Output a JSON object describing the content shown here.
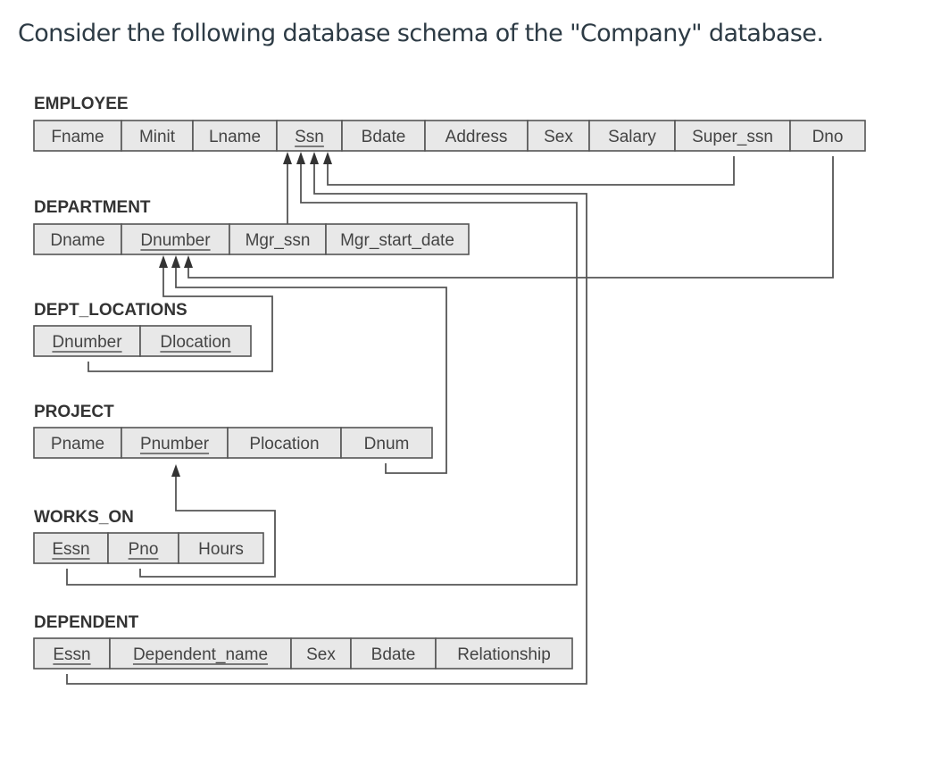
{
  "heading": "Consider the following database schema of the \"Company\" database.",
  "tables": [
    {
      "name": "EMPLOYEE",
      "attributes": [
        {
          "label": "Fname",
          "pk": false
        },
        {
          "label": "Minit",
          "pk": false
        },
        {
          "label": "Lname",
          "pk": false
        },
        {
          "label": "Ssn",
          "pk": true
        },
        {
          "label": "Bdate",
          "pk": false
        },
        {
          "label": "Address",
          "pk": false
        },
        {
          "label": "Sex",
          "pk": false
        },
        {
          "label": "Salary",
          "pk": false
        },
        {
          "label": "Super_ssn",
          "pk": false
        },
        {
          "label": "Dno",
          "pk": false
        }
      ]
    },
    {
      "name": "DEPARTMENT",
      "attributes": [
        {
          "label": "Dname",
          "pk": false
        },
        {
          "label": "Dnumber",
          "pk": true
        },
        {
          "label": "Mgr_ssn",
          "pk": false
        },
        {
          "label": "Mgr_start_date",
          "pk": false
        }
      ]
    },
    {
      "name": "DEPT_LOCATIONS",
      "attributes": [
        {
          "label": "Dnumber",
          "pk": true
        },
        {
          "label": "Dlocation",
          "pk": true
        }
      ]
    },
    {
      "name": "PROJECT",
      "attributes": [
        {
          "label": "Pname",
          "pk": false
        },
        {
          "label": "Pnumber",
          "pk": true
        },
        {
          "label": "Plocation",
          "pk": false
        },
        {
          "label": "Dnum",
          "pk": false
        }
      ]
    },
    {
      "name": "WORKS_ON",
      "attributes": [
        {
          "label": "Essn",
          "pk": true
        },
        {
          "label": "Pno",
          "pk": true
        },
        {
          "label": "Hours",
          "pk": false
        }
      ]
    },
    {
      "name": "DEPENDENT",
      "attributes": [
        {
          "label": "Essn",
          "pk": true
        },
        {
          "label": "Dependent_name",
          "pk": true
        },
        {
          "label": "Sex",
          "pk": false
        },
        {
          "label": "Bdate",
          "pk": false
        },
        {
          "label": "Relationship",
          "pk": false
        }
      ]
    }
  ],
  "foreign_keys": [
    {
      "from": "EMPLOYEE.Super_ssn",
      "to": "EMPLOYEE.Ssn"
    },
    {
      "from": "DEPARTMENT.Mgr_ssn",
      "to": "EMPLOYEE.Ssn"
    },
    {
      "from": "WORKS_ON.Essn",
      "to": "EMPLOYEE.Ssn"
    },
    {
      "from": "DEPENDENT.Essn",
      "to": "EMPLOYEE.Ssn"
    },
    {
      "from": "EMPLOYEE.Dno",
      "to": "DEPARTMENT.Dnumber"
    },
    {
      "from": "DEPT_LOCATIONS.Dnumber",
      "to": "DEPARTMENT.Dnumber"
    },
    {
      "from": "PROJECT.Dnum",
      "to": "DEPARTMENT.Dnumber"
    },
    {
      "from": "WORKS_ON.Pno",
      "to": "PROJECT.Pnumber"
    }
  ]
}
